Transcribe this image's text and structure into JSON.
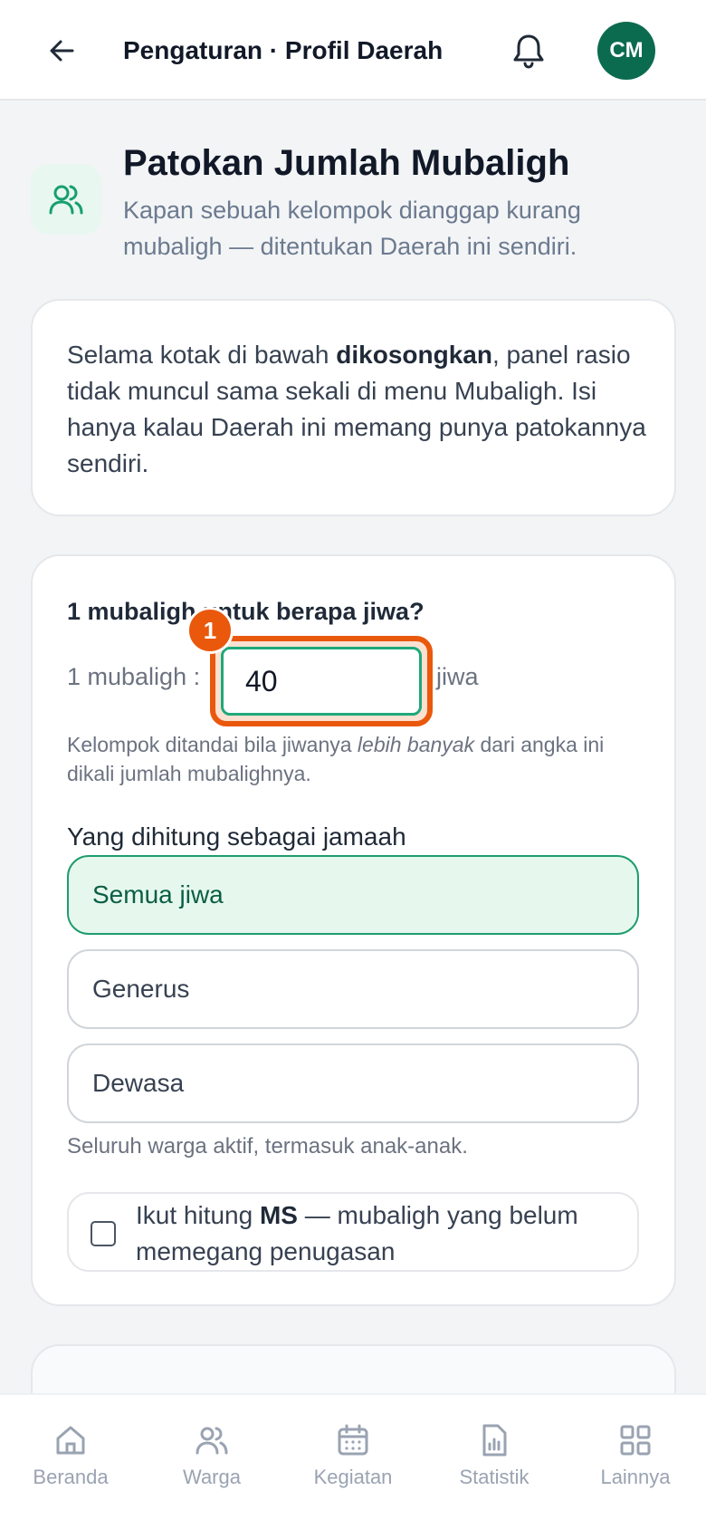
{
  "header": {
    "back_icon": "arrow-left-icon",
    "title": "Pengaturan · Profil Daerah",
    "bell_icon": "bell-icon",
    "avatar_initials": "CM"
  },
  "hero": {
    "icon": "users-icon",
    "title": "Patokan Jumlah Mubaligh",
    "subtitle": "Kapan sebuah kelompok dianggap kurang mubaligh — ditentukan Daerah ini sendiri."
  },
  "info_card": {
    "text_before": "Selama kotak di bawah ",
    "text_bold": "dikosongkan",
    "text_after": ", panel rasio tidak muncul sama sekali di menu Mubaligh. Isi hanya kalau Daerah ini memang punya patokannya sendiri."
  },
  "ratio": {
    "question": "1 mubaligh untuk berapa jiwa?",
    "prefix": "1 mubaligh :",
    "value": "40",
    "suffix": "jiwa",
    "badge": "1",
    "hint_before": "Kelompok ditandai bila jiwanya ",
    "hint_italic": "lebih banyak",
    "hint_after": " dari angka ini dikali jumlah mubalighnya."
  },
  "jamaah": {
    "label": "Yang dihitung sebagai jamaah",
    "options": [
      "Semua jiwa",
      "Generus",
      "Dewasa"
    ],
    "selected": "Semua jiwa",
    "hint": "Seluruh warga aktif, termasuk anak-anak."
  },
  "ms": {
    "checked": false,
    "text_before": "Ikut hitung ",
    "text_bold": "MS",
    "text_after": " — mubaligh yang belum memegang penugasan"
  },
  "nav": {
    "items": [
      {
        "label": "Beranda",
        "icon": "home-icon"
      },
      {
        "label": "Warga",
        "icon": "users-icon"
      },
      {
        "label": "Kegiatan",
        "icon": "calendar-icon"
      },
      {
        "label": "Statistik",
        "icon": "chart-file-icon"
      },
      {
        "label": "Lainnya",
        "icon": "grid-icon"
      }
    ]
  },
  "colors": {
    "accent": "#0b6b4f",
    "highlight": "#ea580c",
    "selected_bg": "#e6f8ee"
  }
}
